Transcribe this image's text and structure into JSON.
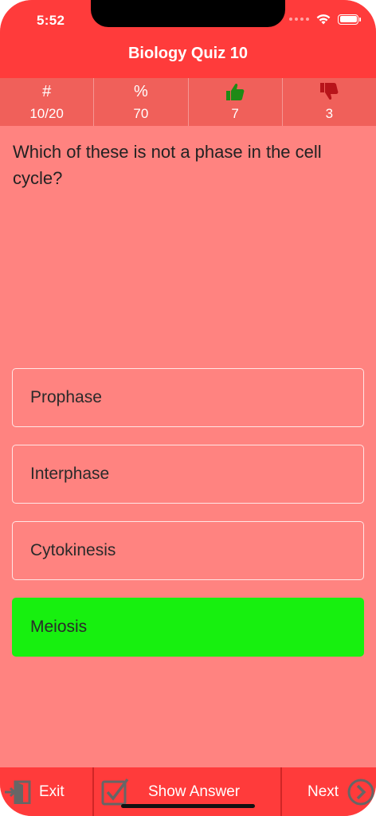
{
  "status_bar": {
    "time": "5:52"
  },
  "header": {
    "title": "Biology Quiz 10"
  },
  "stats": [
    {
      "icon": "hash-icon",
      "symbol": "#",
      "value": "10/20"
    },
    {
      "icon": "percent-icon",
      "symbol": "%",
      "value": "70"
    },
    {
      "icon": "thumbs-up-icon",
      "value": "7",
      "color": "#1f8a16"
    },
    {
      "icon": "thumbs-down-icon",
      "value": "3",
      "color": "#b8141a"
    }
  ],
  "question": {
    "text": "Which of these is not a phase in the cell cycle?"
  },
  "answers": [
    {
      "label": "Prophase",
      "state": "default"
    },
    {
      "label": "Interphase",
      "state": "default"
    },
    {
      "label": "Cytokinesis",
      "state": "default"
    },
    {
      "label": "Meiosis",
      "state": "correct"
    }
  ],
  "bottom_bar": {
    "exit_label": "Exit",
    "show_answer_label": "Show Answer",
    "next_label": "Next"
  },
  "colors": {
    "header": "#ff3b3b",
    "stats_bar": "#f0605a",
    "background": "#ff8380",
    "correct": "#17f00f"
  }
}
